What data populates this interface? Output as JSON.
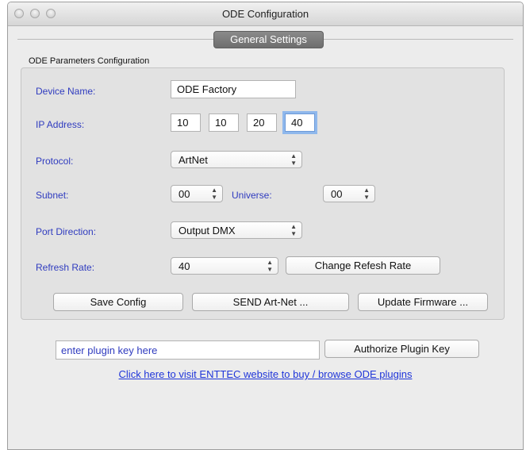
{
  "window": {
    "title": "ODE Configuration"
  },
  "tabs": [
    {
      "label": "General Settings"
    }
  ],
  "group": {
    "title": "ODE Parameters Configuration",
    "device_name": {
      "label": "Device Name:",
      "value": "ODE Factory"
    },
    "ip_address": {
      "label": "IP Address:",
      "octets": [
        "10",
        "10",
        "20",
        "40"
      ]
    },
    "protocol": {
      "label": "Protocol:",
      "selected": "ArtNet"
    },
    "subnet": {
      "label": "Subnet:",
      "selected": "00"
    },
    "universe": {
      "label": "Universe:",
      "selected": "00"
    },
    "port_direction": {
      "label": "Port Direction:",
      "selected": "Output DMX"
    },
    "refresh_rate": {
      "label": "Refresh Rate:",
      "selected": "40",
      "change_button": "Change Refesh Rate"
    },
    "buttons": {
      "save": "Save Config",
      "send": "SEND Art-Net ...",
      "update": "Update Firmware ..."
    }
  },
  "plugin": {
    "placeholder": "enter plugin key here",
    "authorize_button": "Authorize Plugin Key",
    "link": "Click here to visit ENTTEC website to buy / browse ODE plugins "
  },
  "colors": {
    "label_blue": "#2f3bbf",
    "tab_gray": "#7a7a7a",
    "link_blue": "#1f35d9"
  },
  "icons": [
    "close-icon",
    "minimize-icon",
    "zoom-icon",
    "updown-arrows-icon"
  ]
}
